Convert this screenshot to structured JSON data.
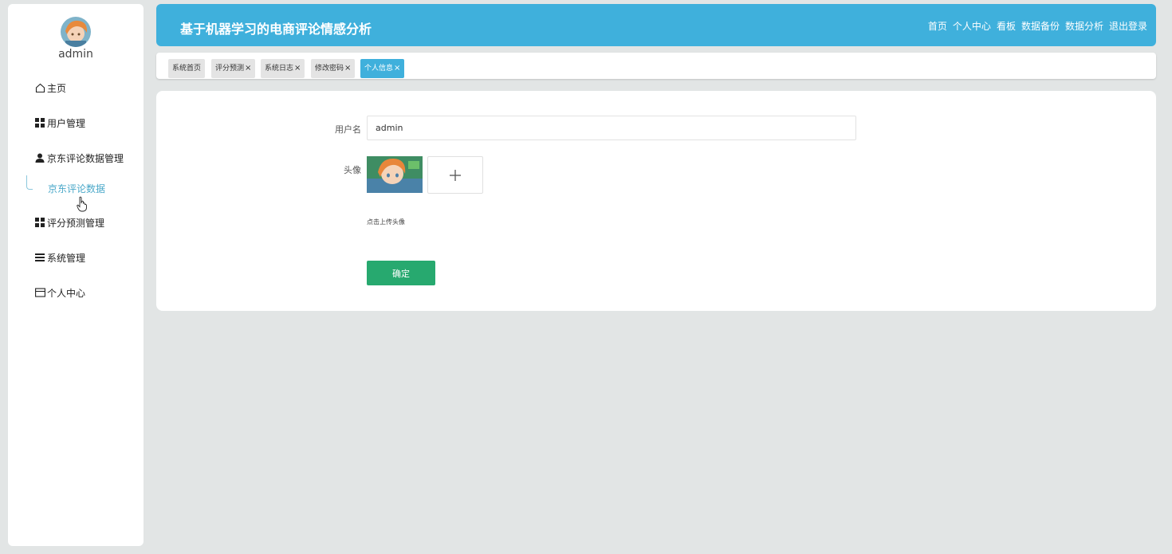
{
  "sidebar": {
    "username": "admin",
    "menu": [
      {
        "label": "主页",
        "icon": "home-icon"
      },
      {
        "label": "用户管理",
        "icon": "grid-icon"
      },
      {
        "label": "京东评论数据管理",
        "icon": "user-icon"
      },
      {
        "label": "评分预测管理",
        "icon": "grid-icon"
      },
      {
        "label": "系统管理",
        "icon": "list-icon"
      },
      {
        "label": "个人中心",
        "icon": "card-icon"
      }
    ],
    "submenu": {
      "label": "京东评论数据"
    }
  },
  "header": {
    "title": "基于机器学习的电商评论情感分析",
    "nav": [
      "首页",
      "个人中心",
      "看板",
      "数据备份",
      "数据分析",
      "退出登录"
    ],
    "bg_color": "#3fb0dc"
  },
  "tabs": [
    {
      "label": "系统首页",
      "closable": false
    },
    {
      "label": "评分预测",
      "closable": true
    },
    {
      "label": "系统日志",
      "closable": true
    },
    {
      "label": "修改密码",
      "closable": true
    },
    {
      "label": "个人信息",
      "closable": true,
      "active": true
    }
  ],
  "form": {
    "username_label": "用户名",
    "username_value": "admin",
    "avatar_label": "头像",
    "upload_hint": "点击上传头像",
    "confirm_label": "确定",
    "confirm_color": "#27a96f"
  }
}
